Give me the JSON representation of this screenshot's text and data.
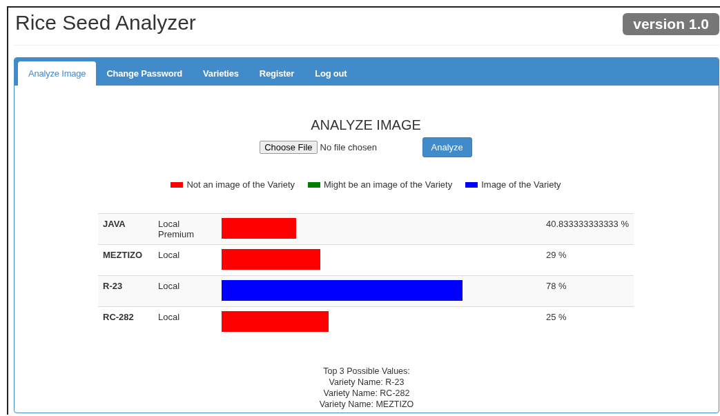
{
  "app_title": "Rice Seed Analyzer",
  "version_badge": "version 1.0",
  "tabs": [
    {
      "label": "Analyze Image",
      "selected": true
    },
    {
      "label": "Change Password",
      "selected": false
    },
    {
      "label": "Varieties",
      "selected": false
    },
    {
      "label": "Register",
      "selected": false
    },
    {
      "label": "Log out",
      "selected": false
    }
  ],
  "heading": "ANALYZE IMAGE",
  "file_input": {
    "button": "Choose File",
    "status": "No file chosen"
  },
  "analyze_button": "Analyze",
  "legend": [
    {
      "label": "Not an image of the Variety",
      "color": "#ff0000"
    },
    {
      "label": "Might be an image of the Variety",
      "color": "#008000"
    },
    {
      "label": "Image of the Variety",
      "color": "#0000ff"
    }
  ],
  "results": [
    {
      "name": "JAVA",
      "type": "Local Premium",
      "level": 0.242,
      "color": "#ff0000",
      "percent": "40.833333333333 %"
    },
    {
      "name": "MEZTIZO",
      "type": "Local",
      "level": 0.32,
      "color": "#ff0000",
      "percent": "29 %"
    },
    {
      "name": "R-23",
      "type": "Local",
      "level": 0.78,
      "color": "#0000ff",
      "percent": "78 %"
    },
    {
      "name": "RC-282",
      "type": "Local",
      "level": 0.347,
      "color": "#ff0000",
      "percent": "25 %"
    }
  ],
  "summary": [
    "Top 3 Possible Values:",
    "Variety Name: R-23",
    "Variety Name: RC-282",
    "Variety Name: MEZTIZO"
  ]
}
